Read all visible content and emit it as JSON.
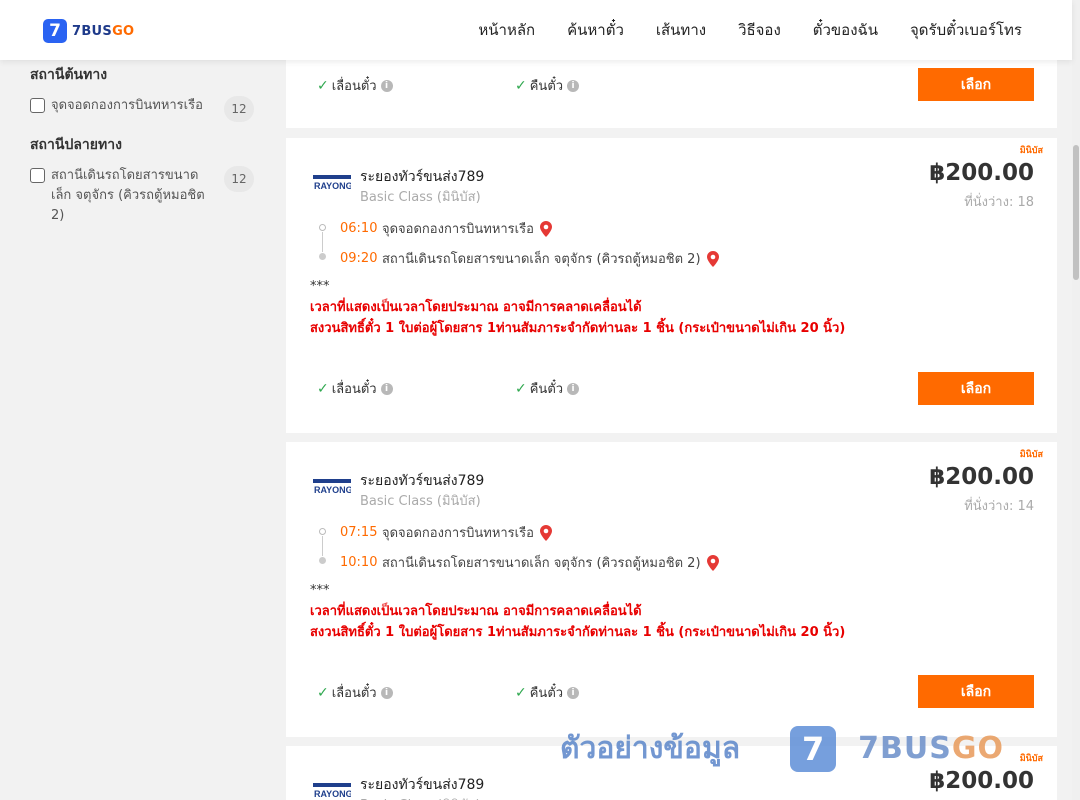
{
  "header": {
    "logo_number": "7",
    "logo_text_main": "7BUS",
    "logo_text_accent": "GO",
    "nav": [
      "หน้าหลัก",
      "ค้นหาตั๋ว",
      "เส้นทาง",
      "วิธีจอง",
      "ตั๋วของฉัน",
      "จุดรับตั๋วเบอร์โทร"
    ]
  },
  "sidebar": {
    "origin_title": "สถานีต้นทาง",
    "origin_items": [
      {
        "label": "จุดจอดกองการบินทหารเรือ",
        "count": "12"
      }
    ],
    "destination_title": "สถานีปลายทาง",
    "destination_items": [
      {
        "label": "สถานีเดินรถโดยสารขนาดเล็ก จตุจักร (คิวรถตู้หมอชิต 2)",
        "count": "12"
      }
    ]
  },
  "common": {
    "reschedule": "เลื่อนตั๋ว",
    "refund": "คืนตั๋ว",
    "select": "เลือก",
    "tag": "มินิบัส",
    "stars": "***",
    "note_line1": "เวลาที่แสดงเป็นเวลาโดยประมาณ อาจมีการคลาดเคลื่อนได้",
    "note_line2": "สงวนสิทธิ์ตั๋ว 1 ใบต่อผู้โดยสาร 1ท่านสัมภาระจำกัดท่านละ 1 ชิ้น (กระเป๋าขนาดไม่เกิน 20 นิ้ว)",
    "brand_logo_text": "RAYONG"
  },
  "cards": [
    {
      "operator": "ระยองทัวร์ขนส่ง789",
      "class": "Basic Class (มินิบัส)",
      "price": "฿200.00",
      "seats": "ที่นั่งว่าง: 18",
      "depart_time": "06:10",
      "depart_station": "จุดจอดกองการบินทหารเรือ",
      "arrive_time": "09:20",
      "arrive_station": "สถานีเดินรถโดยสารขนาดเล็ก จตุจักร (คิวรถตู้หมอชิต 2)"
    },
    {
      "operator": "ระยองทัวร์ขนส่ง789",
      "class": "Basic Class (มินิบัส)",
      "price": "฿200.00",
      "seats": "ที่นั่งว่าง: 14",
      "depart_time": "07:15",
      "depart_station": "จุดจอดกองการบินทหารเรือ",
      "arrive_time": "10:10",
      "arrive_station": "สถานีเดินรถโดยสารขนาดเล็ก จตุจักร (คิวรถตู้หมอชิต 2)"
    },
    {
      "operator": "ระยองทัวร์ขนส่ง789",
      "class": "Basic Class (มินิบัส)",
      "price": "฿200.00"
    }
  ],
  "watermark": {
    "text": "ตัวอย่างข้อมูล",
    "mark": "7",
    "brand_main": "7BUS",
    "brand_accent": "GO"
  },
  "colors": {
    "accent": "#ff6a00",
    "logo_blue": "#2a63f2",
    "note_red": "#e80000",
    "check_green": "#2fa84f"
  }
}
